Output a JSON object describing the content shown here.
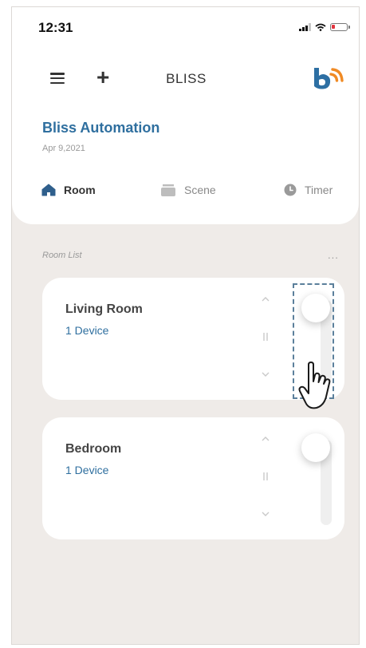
{
  "status_bar": {
    "time": "12:31"
  },
  "header": {
    "title": "BLISS"
  },
  "home": {
    "name": "Bliss Automation",
    "date": "Apr 9,2021"
  },
  "tabs": [
    {
      "label": "Room",
      "icon": "home-icon",
      "active": true
    },
    {
      "label": "Scene",
      "icon": "scene-icon",
      "active": false
    },
    {
      "label": "Timer",
      "icon": "clock-icon",
      "active": false
    }
  ],
  "room_list": {
    "label": "Room List",
    "more": "...",
    "rooms": [
      {
        "name": "Living Room",
        "devices": "1 Device",
        "highlighted": true
      },
      {
        "name": "Bedroom",
        "devices": "1 Device",
        "highlighted": false
      }
    ]
  },
  "colors": {
    "accent": "#2f6f9f",
    "logo_blue": "#2d6fa3",
    "logo_orange": "#f08a24",
    "background": "#efebe8"
  }
}
